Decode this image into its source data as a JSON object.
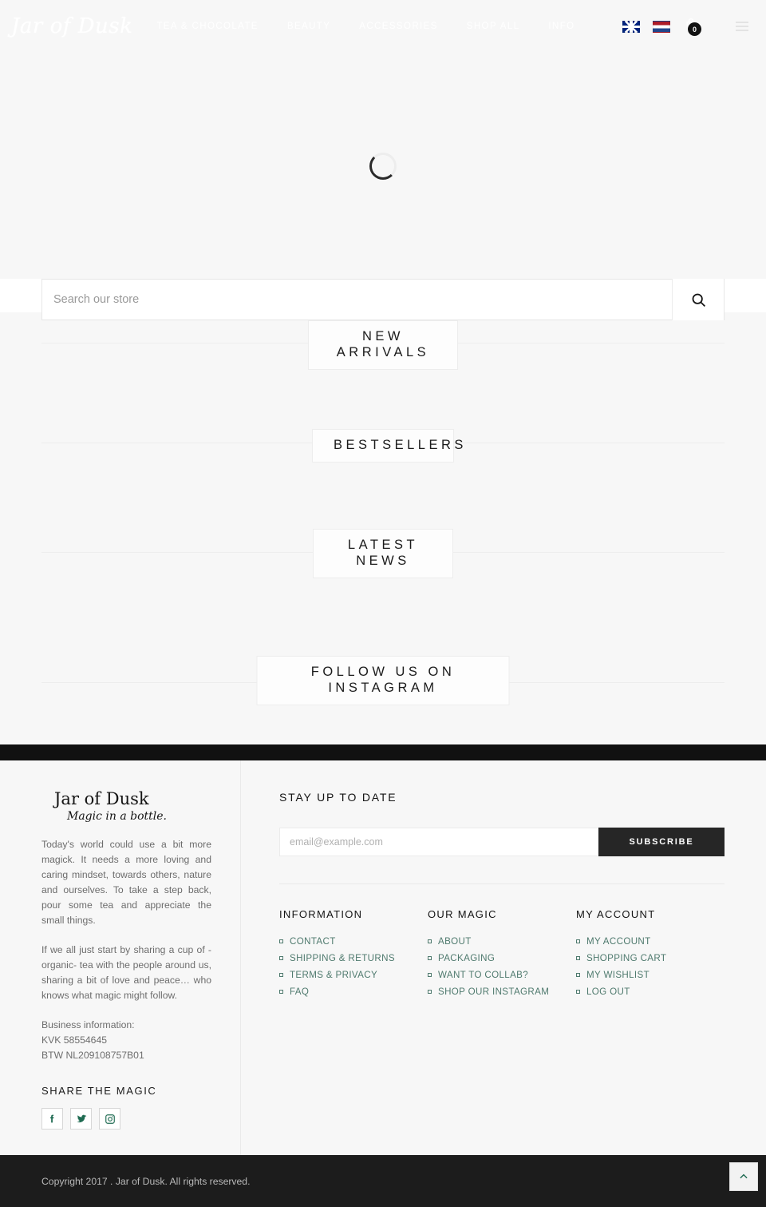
{
  "header": {
    "logo": "Jar of Dusk",
    "nav": [
      {
        "label": "TEA & CHOCOLATE"
      },
      {
        "label": "BEAUTY"
      },
      {
        "label": "ACCESSORIES"
      },
      {
        "label": "SHOP ALL"
      },
      {
        "label": "INFO"
      }
    ],
    "lang_en": "flag-uk-icon",
    "lang_nl": "flag-nl-icon",
    "cart_count": "0",
    "menu_icon": "hamburger-icon"
  },
  "search": {
    "placeholder": "Search our store",
    "value": "",
    "button_icon": "search-icon"
  },
  "sections": [
    {
      "title": "NEW ARRIVALS"
    },
    {
      "title": "BESTSELLERS"
    },
    {
      "title": "LATEST NEWS"
    },
    {
      "title": "FOLLOW US ON INSTAGRAM"
    }
  ],
  "footer": {
    "logo": "Jar of Dusk",
    "logo_tagline": "Magic in a bottle.",
    "paragraph1": "Today's world could use a bit more magick. It needs a more loving and caring mindset, towards others, nature and ourselves. To take a step back, pour some tea and appreciate the small things.",
    "paragraph2": "If we all just start by sharing a cup of -organic- tea with the people around us, sharing a bit of love and peace… who knows what magic might follow.",
    "business_label": "Business information:",
    "kvk": "KVK 58554645",
    "btw": "BTW NL209108757B01",
    "share_title": "SHARE THE MAGIC",
    "social": [
      {
        "name": "facebook-icon"
      },
      {
        "name": "twitter-icon"
      },
      {
        "name": "instagram-icon"
      }
    ],
    "newsletter": {
      "title": "STAY UP TO DATE",
      "placeholder": "email@example.com",
      "value": "",
      "button": "SUBSCRIBE"
    },
    "columns": [
      {
        "heading": "INFORMATION",
        "links": [
          "CONTACT",
          "SHIPPING & RETURNS",
          "TERMS & PRIVACY",
          "FAQ"
        ]
      },
      {
        "heading": "OUR MAGIC",
        "links": [
          "ABOUT",
          "PACKAGING",
          "WANT TO COLLAB?",
          "SHOP OUR INSTAGRAM"
        ]
      },
      {
        "heading": "MY ACCOUNT",
        "links": [
          "MY ACCOUNT",
          "SHOPPING CART",
          "MY WISHLIST",
          "LOG OUT"
        ]
      }
    ],
    "copyright": "Copyright 2017 . Jar of Dusk. All rights reserved.",
    "back_to_top": "chevron-up-icon"
  },
  "colors": {
    "link_green": "#4f7a6e",
    "dark": "#1c1c1c",
    "page_bg": "#f7f7f7"
  }
}
